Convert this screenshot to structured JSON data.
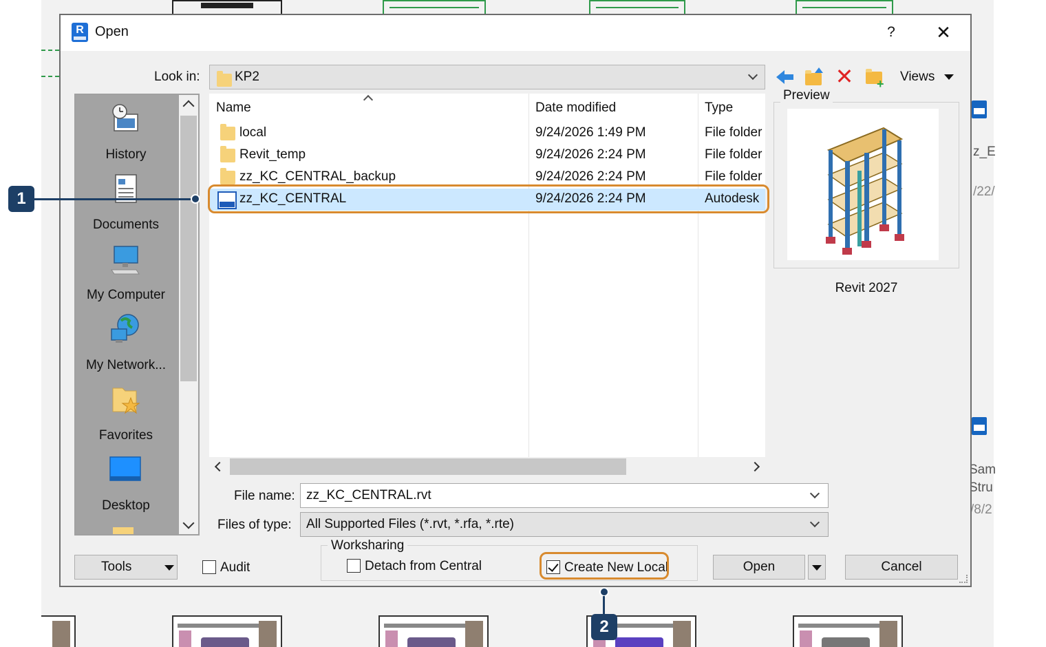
{
  "background": {
    "partial_texts": [
      "z_E",
      "/22/",
      "Sam",
      "Stru",
      "/8/2"
    ]
  },
  "dialog": {
    "title": "Open",
    "help_label": "?",
    "close_label": "✕"
  },
  "look_in": {
    "label": "Look in:",
    "value": "KP2"
  },
  "toolbar": {
    "views_label": "Views"
  },
  "places": [
    {
      "label": "History",
      "icon": "history-icon"
    },
    {
      "label": "Documents",
      "icon": "documents-icon"
    },
    {
      "label": "My Computer",
      "icon": "computer-icon"
    },
    {
      "label": "My Network...",
      "icon": "network-icon"
    },
    {
      "label": "Favorites",
      "icon": "favorites-icon"
    },
    {
      "label": "Desktop",
      "icon": "desktop-icon"
    }
  ],
  "columns": {
    "name": "Name",
    "date": "Date modified",
    "type": "Type"
  },
  "files": [
    {
      "name": "local",
      "date": "9/24/2026 1:49 PM",
      "type": "File folder",
      "kind": "folder"
    },
    {
      "name": "Revit_temp",
      "date": "9/24/2026 2:24 PM",
      "type": "File folder",
      "kind": "folder"
    },
    {
      "name": "zz_KC_CENTRAL_backup",
      "date": "9/24/2026 2:24 PM",
      "type": "File folder",
      "kind": "folder"
    },
    {
      "name": "zz_KC_CENTRAL",
      "date": "9/24/2026 2:24 PM",
      "type": "Autodesk",
      "kind": "rvt",
      "selected": true
    }
  ],
  "preview": {
    "label": "Preview",
    "version": "Revit 2027"
  },
  "file_name": {
    "label": "File name:",
    "value": "zz_KC_CENTRAL.rvt"
  },
  "file_type": {
    "label": "Files of type:",
    "value": "All Supported Files (*.rvt, *.rfa, *.rte)"
  },
  "bottom": {
    "tools_label": "Tools",
    "audit_label": "Audit",
    "audit_checked": false,
    "worksharing_label": "Worksharing",
    "detach_label": "Detach from Central",
    "detach_checked": false,
    "create_local_label": "Create New Local",
    "create_local_checked": true,
    "open_label": "Open",
    "cancel_label": "Cancel"
  },
  "callouts": [
    {
      "number": "1"
    },
    {
      "number": "2"
    }
  ],
  "colors": {
    "accent_orange": "#d88a2e",
    "badge_navy": "#1d3f66",
    "selection": "#cce8ff"
  }
}
